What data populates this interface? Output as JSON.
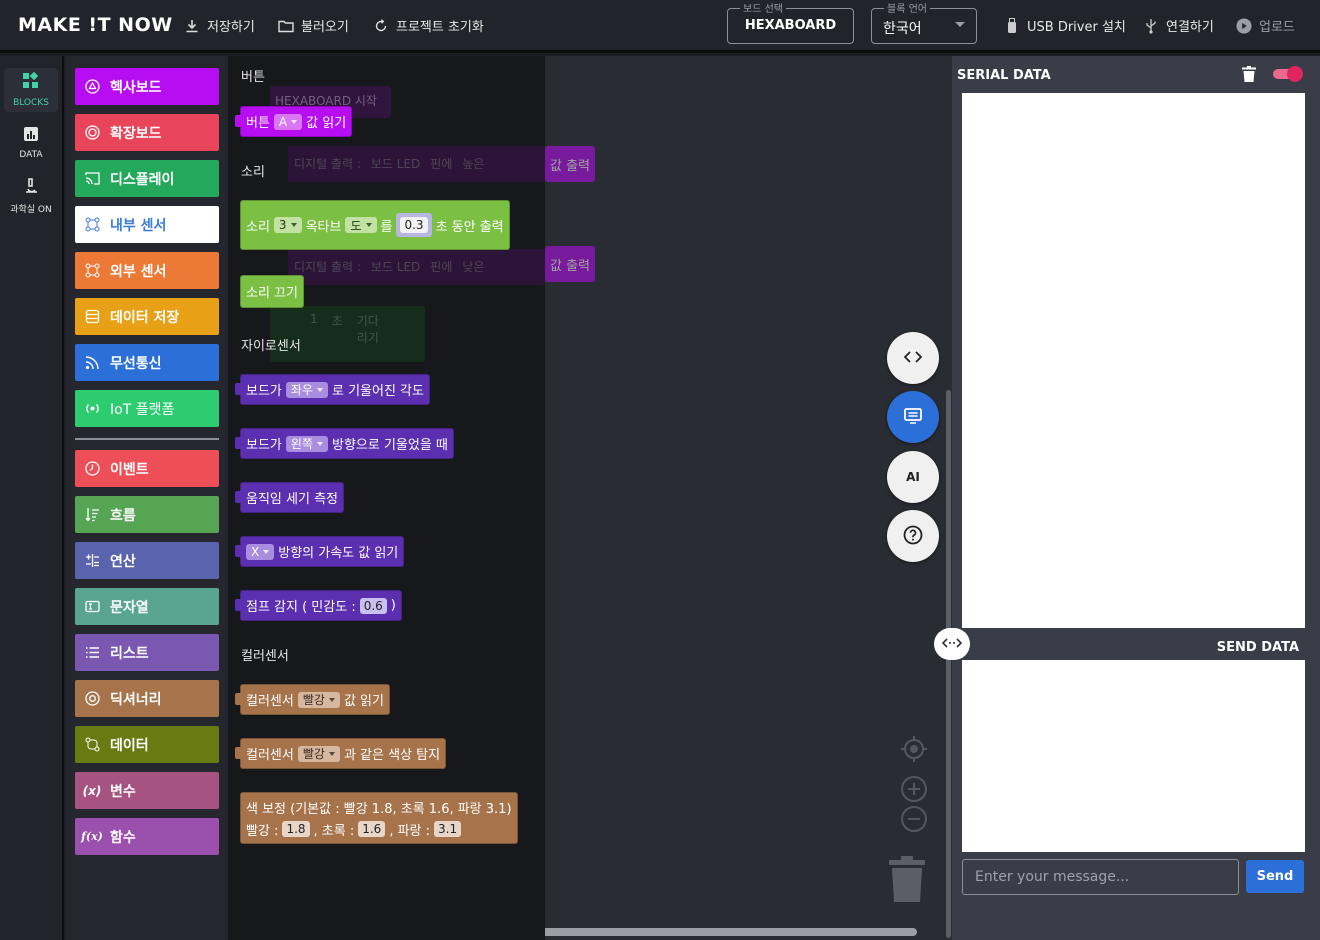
{
  "app": {
    "logo": "MAKE !T NOW",
    "toolbar": {
      "save": "저장하기",
      "open": "불러오기",
      "reset": "프로젝트 초기화",
      "board_legend": "보드 선택",
      "board_value": "HEXABOARD",
      "lang_legend": "블록 언어",
      "lang_value": "한국어",
      "usb": "USB Driver 설치",
      "connect": "연결하기",
      "upload": "업로드"
    }
  },
  "rail": {
    "items": [
      {
        "label": "BLOCKS",
        "icon": "blocks-icon"
      },
      {
        "label": "DATA",
        "icon": "chart-icon"
      },
      {
        "label": "과학실 ON",
        "icon": "microscope-icon"
      }
    ]
  },
  "categories": [
    {
      "label": "헥사보드",
      "color": "#b70df2"
    },
    {
      "label": "확장보드",
      "color": "#e8445a"
    },
    {
      "label": "디스플레이",
      "color": "#24a85c"
    },
    {
      "label": "내부 센서",
      "color": "#ffffff"
    },
    {
      "label": "외부 센서",
      "color": "#ec7a36"
    },
    {
      "label": "데이터 저장",
      "color": "#e8a016"
    },
    {
      "label": "무선통신",
      "color": "#2d6fd9"
    },
    {
      "label": "IoT 플랫폼",
      "color": "#2ecc71"
    },
    {
      "label": "이벤트",
      "color": "#ed4e57"
    },
    {
      "label": "흐름",
      "color": "#55a555"
    },
    {
      "label": "연산",
      "color": "#5a63ad"
    },
    {
      "label": "문자열",
      "color": "#59a592"
    },
    {
      "label": "리스트",
      "color": "#7a58b1"
    },
    {
      "label": "딕셔너리",
      "color": "#a6734b"
    },
    {
      "label": "데이터",
      "color": "#687a10"
    },
    {
      "label": "변수",
      "color": "#a65382"
    },
    {
      "label": "함수",
      "color": "#9b50ad"
    }
  ],
  "flyout": {
    "sections": {
      "button": "버튼",
      "sound": "소리",
      "gyro": "자이로센서",
      "color": "컬러센서"
    },
    "blocks": {
      "btn_read": {
        "pre": "버튼",
        "dd": "A",
        "post": "값 읽기"
      },
      "sound_play": {
        "pre": "소리",
        "dd1": "3",
        "mid1": "옥타브",
        "dd2": "도",
        "mid2": "를",
        "num": "0.3",
        "post": "초 동안 출력"
      },
      "sound_off": {
        "text": "소리 끄기"
      },
      "tilt_angle": {
        "pre": "보드가",
        "dd": "좌우",
        "post": "로 기울어진 각도"
      },
      "tilt_dir": {
        "pre": "보드가",
        "dd": "왼쪽",
        "post": "방향으로 기울었을 때"
      },
      "motion": {
        "text": "움직임 세기 측정"
      },
      "accel": {
        "dd": "X",
        "post": "방향의 가속도 값 읽기"
      },
      "jump": {
        "pre": "점프 감지 ( 민감도 :",
        "num": "0.6",
        "post": ")"
      },
      "color_read": {
        "pre": "컬러센서",
        "dd": "빨강",
        "post": "값 읽기"
      },
      "color_detect": {
        "pre": "컬러센서",
        "dd": "빨강",
        "post": "과 같은 색상 탐지"
      },
      "color_calib": {
        "line1": "색 보정 (기본값 : 빨강 1.8, 초록 1.6, 파랑 3.1)",
        "r_label": "빨강 :",
        "r": "1.8",
        "g_label": ", 초록 :",
        "g": "1.6",
        "b_label": ", 파랑 :",
        "b": "3.1"
      }
    }
  },
  "workspace": {
    "ghost_start": "HEXABOARD 시작",
    "ghost_digital": "디지털 출력 :",
    "ghost_led": "보드 LED",
    "ghost_pin": "핀에",
    "ghost_high": "높은",
    "ghost_low": "낮은",
    "ghost_val_out": "값 출력",
    "ghost_wait_num": "1",
    "ghost_wait_unit": "초",
    "ghost_wait": "기다리기",
    "fab_ai": "AI"
  },
  "serial": {
    "title": "SERIAL DATA",
    "send_title": "SEND DATA",
    "placeholder": "Enter your message...",
    "send_label": "Send"
  }
}
